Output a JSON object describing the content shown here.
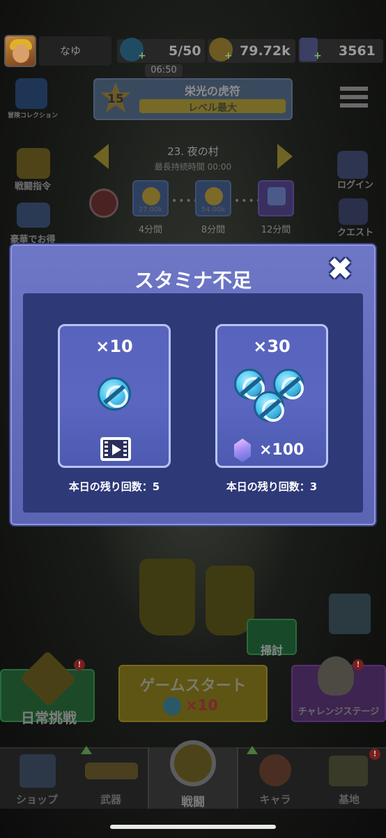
{
  "topbar": {
    "username": "なゆ",
    "stamina": "5/50",
    "coins": "79.72k",
    "gems": "3561",
    "timer": "06:50",
    "plus": "+"
  },
  "left_menu": {
    "collection": "冒険コレクション",
    "battle_order": "戦闘指令",
    "deluxe": "豪華でお得"
  },
  "right_menu": {
    "login": "ログイン",
    "quest": "クエスト"
  },
  "glory": {
    "level": "15",
    "title": "栄光の虎符",
    "bar_label": "レベル最大"
  },
  "stage": {
    "name": "23. 夜の村",
    "sub": "最長持続時間 00:00",
    "rewards": [
      {
        "value": "27.00k",
        "time": "4分間"
      },
      {
        "value": "54.00k",
        "time": "8分間"
      },
      {
        "value": "",
        "time": "12分間"
      }
    ],
    "dots": "•••••"
  },
  "modal": {
    "title": "スタミナ不足",
    "close_symbol": "✖",
    "options": [
      {
        "count": "×10",
        "remaining": "本日の残り回数：5",
        "cost_type": "video-ad"
      },
      {
        "count": "×30",
        "remaining": "本日の残り回数：3",
        "cost_type": "gem",
        "price": "×100"
      }
    ]
  },
  "bottom": {
    "daily_challenge": "日常挑戦",
    "game_start": "ゲームスタート",
    "game_start_cost": "×10",
    "challenge_stage": "チャレンジステージ",
    "sweep": "掃討",
    "badge": "!"
  },
  "tabs": [
    {
      "label": "ショップ"
    },
    {
      "label": "武器"
    },
    {
      "label": "戦闘"
    },
    {
      "label": "キャラ"
    },
    {
      "label": "基地"
    }
  ],
  "colors": {
    "modal_bg": "#6e77c6",
    "modal_inner": "#2e3978",
    "card_border": "#b8c4f2",
    "bolt": "#4fc8f0"
  }
}
